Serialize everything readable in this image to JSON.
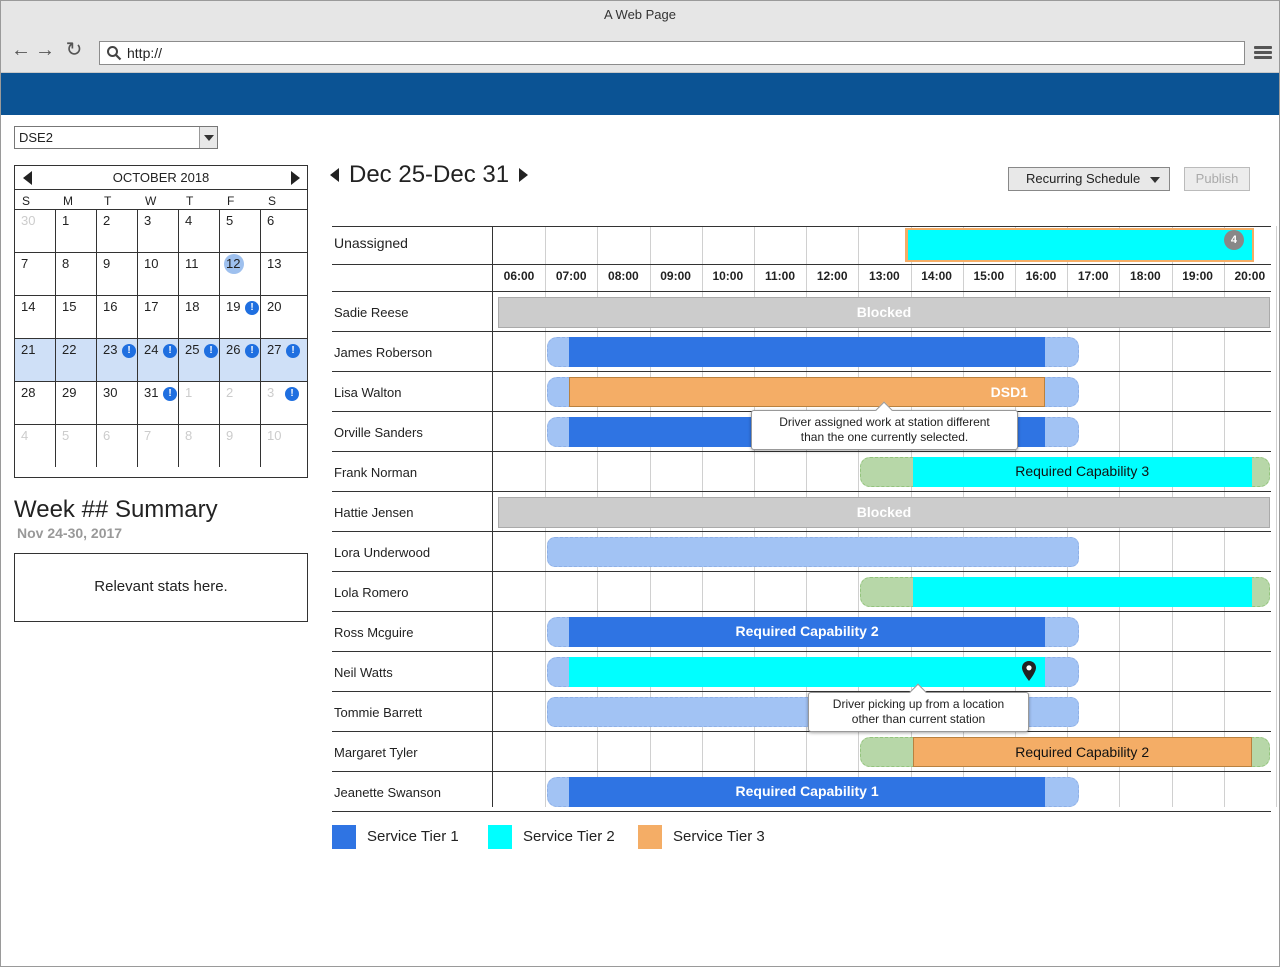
{
  "browser": {
    "title": "A Web Page",
    "url": "http://"
  },
  "station": {
    "selected": "DSE2"
  },
  "calendar": {
    "month_label": "OCTOBER 2018",
    "weekdays": [
      "S",
      "M",
      "T",
      "W",
      "T",
      "F",
      "S"
    ],
    "weeks": [
      [
        {
          "d": "30",
          "muted": true
        },
        {
          "d": "1"
        },
        {
          "d": "2"
        },
        {
          "d": "3"
        },
        {
          "d": "4"
        },
        {
          "d": "5"
        },
        {
          "d": "6"
        }
      ],
      [
        {
          "d": "7"
        },
        {
          "d": "8"
        },
        {
          "d": "9"
        },
        {
          "d": "10"
        },
        {
          "d": "11"
        },
        {
          "d": "12",
          "today": true
        },
        {
          "d": "13"
        }
      ],
      [
        {
          "d": "14"
        },
        {
          "d": "15"
        },
        {
          "d": "16"
        },
        {
          "d": "17"
        },
        {
          "d": "18"
        },
        {
          "d": "19",
          "alert": true
        },
        {
          "d": "20"
        }
      ],
      [
        {
          "d": "21",
          "week": true
        },
        {
          "d": "22",
          "week": true
        },
        {
          "d": "23",
          "week": true,
          "alert": true
        },
        {
          "d": "24",
          "week": true,
          "alert": true
        },
        {
          "d": "25",
          "week": true,
          "alert": true
        },
        {
          "d": "26",
          "week": true,
          "alert": true
        },
        {
          "d": "27",
          "week": true,
          "alert": true
        }
      ],
      [
        {
          "d": "28"
        },
        {
          "d": "29"
        },
        {
          "d": "30"
        },
        {
          "d": "31",
          "alert": true
        },
        {
          "d": "1",
          "muted": true
        },
        {
          "d": "2",
          "muted": true
        },
        {
          "d": "3",
          "muted": true,
          "alert": true
        }
      ],
      [
        {
          "d": "4",
          "muted": true
        },
        {
          "d": "5",
          "muted": true
        },
        {
          "d": "6",
          "muted": true
        },
        {
          "d": "7",
          "muted": true
        },
        {
          "d": "8",
          "muted": true
        },
        {
          "d": "9",
          "muted": true
        },
        {
          "d": "10",
          "muted": true
        }
      ]
    ]
  },
  "summary": {
    "title": "Week ## Summary",
    "date_range": "Nov 24-30, 2017",
    "stats_text": "Relevant stats here."
  },
  "week": {
    "range_label": "Dec 25-Dec 31"
  },
  "actions": {
    "recurring_label": "Recurring Schedule",
    "publish_label": "Publish"
  },
  "schedule": {
    "unassigned_label": "Unassigned",
    "unassigned_count": "4",
    "hours": [
      "06:00",
      "07:00",
      "08:00",
      "09:00",
      "10:00",
      "11:00",
      "12:00",
      "13:00",
      "14:00",
      "15:00",
      "16:00",
      "17:00",
      "18:00",
      "19:00",
      "20:00"
    ],
    "drivers": [
      {
        "name": "Sadie Reese",
        "shift": {
          "kind": "blocked",
          "label": "Blocked"
        }
      },
      {
        "name": "James Roberson",
        "shift": {
          "kind": "tier",
          "tier": 1,
          "start": 7,
          "end": 17,
          "label": ""
        }
      },
      {
        "name": "Lisa Walton",
        "shift": {
          "kind": "tier",
          "tier": 3,
          "start": 7,
          "end": 17,
          "label": "DSD1"
        }
      },
      {
        "name": "Orville Sanders",
        "shift": {
          "kind": "tier",
          "tier": 1,
          "start": 7,
          "end": 17,
          "label": ""
        }
      },
      {
        "name": "Frank Norman",
        "shift": {
          "kind": "tier",
          "tier": 2,
          "start": 13,
          "end": 21,
          "label": "Required Capability 3"
        }
      },
      {
        "name": "Hattie Jensen",
        "shift": {
          "kind": "blocked",
          "label": "Blocked"
        }
      },
      {
        "name": "Lora Underwood",
        "shift": {
          "kind": "available",
          "start": 7,
          "end": 17
        }
      },
      {
        "name": "Lola Romero",
        "shift": {
          "kind": "tier",
          "tier": 2,
          "start": 13,
          "end": 21,
          "label": ""
        }
      },
      {
        "name": "Ross Mcguire",
        "shift": {
          "kind": "tier",
          "tier": 1,
          "start": 7,
          "end": 17,
          "label": "Required Capability 2"
        }
      },
      {
        "name": "Neil Watts",
        "shift": {
          "kind": "tier",
          "tier": 2,
          "start": 7,
          "end": 17,
          "label": "",
          "pin": true
        }
      },
      {
        "name": "Tommie Barrett",
        "shift": {
          "kind": "available",
          "start": 7,
          "end": 17
        }
      },
      {
        "name": "Margaret Tyler",
        "shift": {
          "kind": "tier",
          "tier": 3,
          "start": 13,
          "end": 21,
          "label": "Required Capability 2"
        }
      },
      {
        "name": "Jeanette Swanson",
        "shift": {
          "kind": "tier",
          "tier": 1,
          "start": 7,
          "end": 17,
          "label": "Required Capability 1"
        }
      }
    ]
  },
  "tooltips": [
    {
      "text_1": "Driver assigned work at station different",
      "text_2": "than the one currently selected."
    },
    {
      "text_1": "Driver picking up from a location",
      "text_2": "other than current station"
    }
  ],
  "legend": [
    {
      "label": "Service Tier 1",
      "color": "#2f74e3"
    },
    {
      "label": "Service Tier 2",
      "color": "#00ffff"
    },
    {
      "label": "Service Tier 3",
      "color": "#f4ad66"
    }
  ],
  "colors": {
    "header": "#0b5394",
    "tier1": "#2f74e3",
    "tier2": "#00ffff",
    "tier3": "#f4ad66",
    "available": "#a2c3f4",
    "flex": "#b7d7a8",
    "blocked": "#cccccc",
    "week_highlight": "#cfe0f7"
  },
  "icons": [
    "back-arrow-icon",
    "forward-arrow-icon",
    "reload-icon",
    "search-icon",
    "hamburger-menu-icon",
    "chevron-left-icon",
    "chevron-right-icon",
    "alert-icon",
    "location-pin-icon"
  ]
}
